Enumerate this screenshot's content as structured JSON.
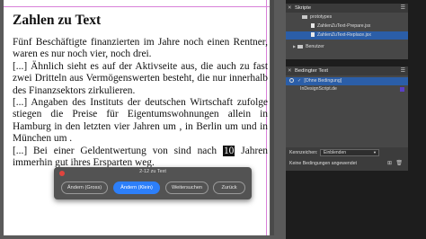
{
  "document": {
    "title": "Zahlen zu Text",
    "paragraphs": [
      "Fünf Beschäftigte finanzierten im Jahre  noch einen Rentner,  waren es nur noch vier,  noch drei.",
      "[...] Ähnlich sieht es auf der Aktivseite aus, die auch zu fast zwei Dritteln aus Vermögenswerten besteht, die nur innerhalb des Finanzsektors zirkulieren.",
      "[...] Angaben des Instituts der deutschen Wirtschaft zufolge stiegen die Preise für Eigentumswohnungen allein in Hamburg in den letzten vier Jahren um , in Berlin um  und in München um .",
      "[...] Bei einer Geldentwertung von  sind nach "
    ],
    "highlight": "10",
    "last_tail": " Jahren  immerhin gut  ihres Ersparten weg."
  },
  "dialog": {
    "title": "2-12 zu Text",
    "buttons": [
      "Ändern (Gross)",
      "Ändern (Klein)",
      "Weitersuchen",
      "Zurück"
    ],
    "active_index": 1,
    "accent_color": "#2d7ff9"
  },
  "scripts_panel": {
    "title": "Skripte",
    "items": [
      {
        "label": "prototypes",
        "type": "folder"
      },
      {
        "label": "ZahlenZuText-Prepare.jsx",
        "type": "file"
      },
      {
        "label": "ZahlenZuText-Replace.jsx",
        "type": "file",
        "selected": true
      },
      {
        "label": "Benutzer",
        "type": "folder"
      }
    ]
  },
  "conditions_panel": {
    "title": "Bedingter Text",
    "items": [
      {
        "label": "[Ohne Bedingung]",
        "checked": true,
        "selected": true
      },
      {
        "label": "InDesignScript.de",
        "swatch": "#5a3fc8"
      }
    ],
    "show_label": "Kennzeichen:",
    "show_value": "Einblenden",
    "status": "Keine Bedingungen angewendet"
  }
}
